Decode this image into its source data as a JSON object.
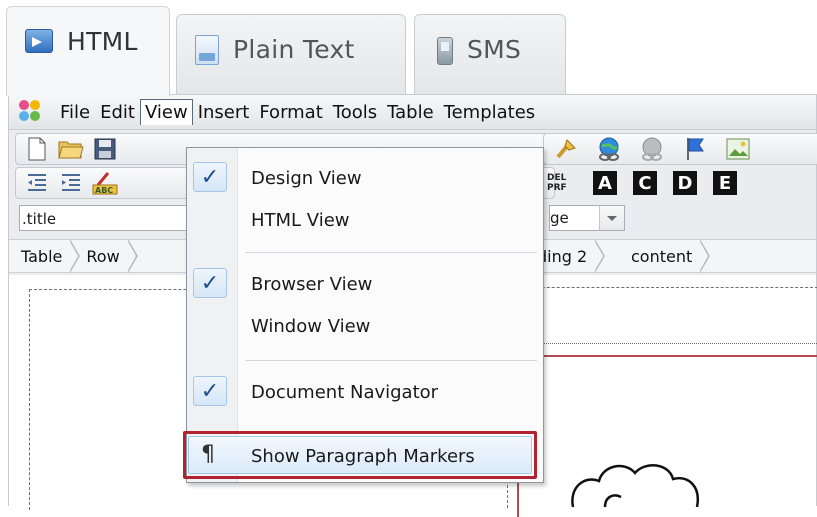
{
  "tabs": [
    {
      "label": "HTML",
      "icon": "html-icon",
      "active": true
    },
    {
      "label": "Plain Text",
      "icon": "document-icon",
      "active": false
    },
    {
      "label": "SMS",
      "icon": "phone-icon",
      "active": false
    }
  ],
  "menubar": {
    "items": [
      "File",
      "Edit",
      "View",
      "Insert",
      "Format",
      "Tools",
      "Table",
      "Templates"
    ],
    "open_menu": "View"
  },
  "toolbar": {
    "row2_right_text": {
      "del": "DEL",
      "prf": "PRF"
    },
    "letters": [
      "A",
      "C",
      "D",
      "E"
    ]
  },
  "style": {
    "selector_value": ".title",
    "second_select_value": "ge"
  },
  "breadcrumb": [
    "Table",
    "Row",
    "ding 2",
    "content"
  ],
  "view_menu": {
    "items": [
      {
        "label": "Design View",
        "checked": true
      },
      {
        "label": "HTML View",
        "checked": false
      },
      {
        "label": "Browser View",
        "checked": true
      },
      {
        "label": "Window View",
        "checked": false
      },
      {
        "label": "Document Navigator",
        "checked": true
      },
      {
        "label": "Show Paragraph Markers",
        "checked": false,
        "icon": "¶",
        "highlighted": true
      }
    ]
  },
  "colors": {
    "highlight_border": "#b2232f",
    "check_blue": "#1c4f8c"
  }
}
